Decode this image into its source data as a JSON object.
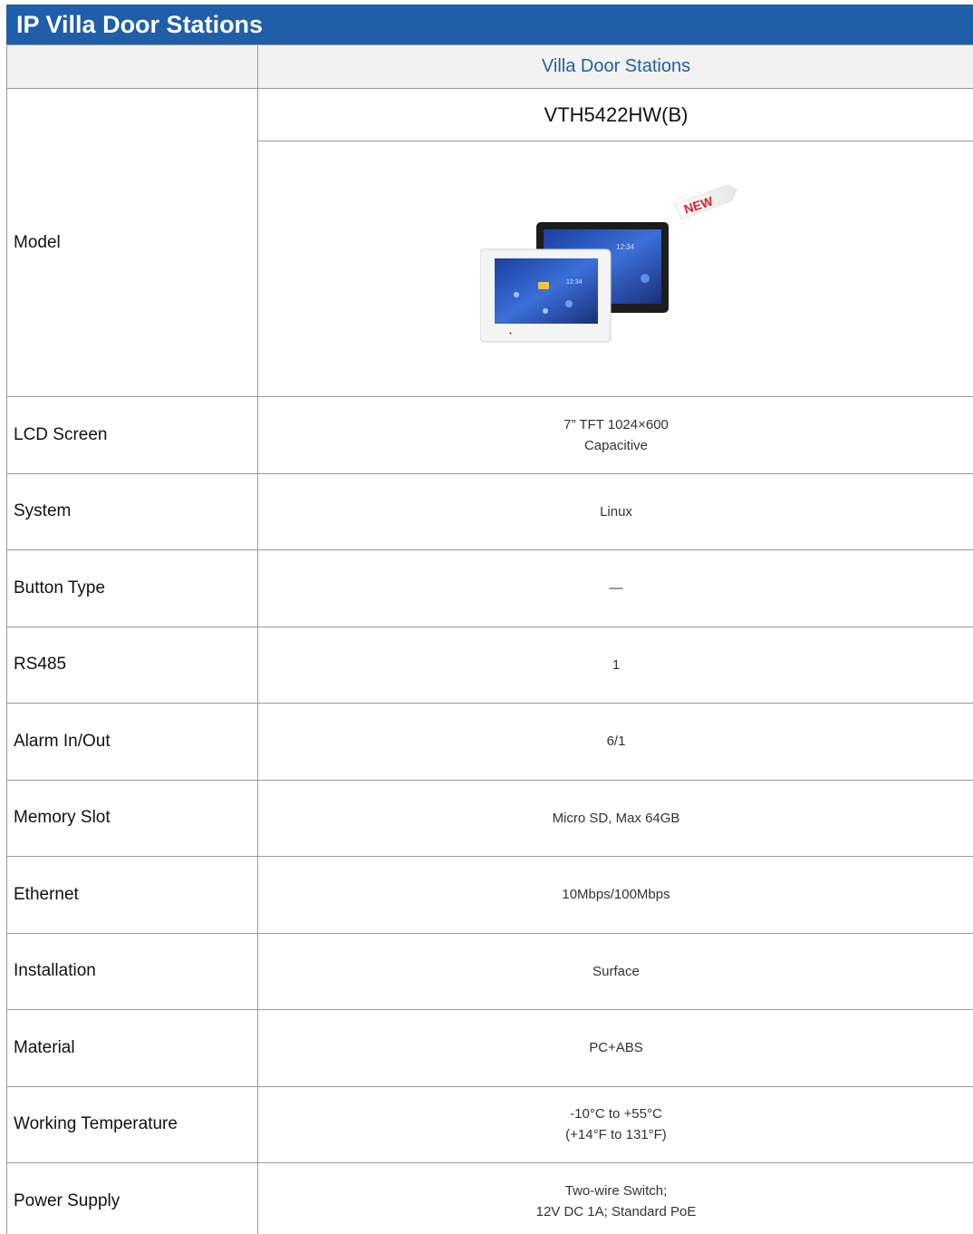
{
  "page": {
    "title": "IP Villa Door Stations",
    "series_header": "Villa Door Stations",
    "model_label": "Model",
    "model_name": "VTH5422HW(B)",
    "new_badge": "NEW",
    "screen_clock": "12:34"
  },
  "colors": {
    "brand_blue": "#1f5ea8",
    "header_gray": "#f2f2f2",
    "new_badge_red": "#d9232d"
  },
  "specs": [
    {
      "label": "LCD Screen",
      "value": [
        "7” TFT 1024×600",
        "Capacitive"
      ]
    },
    {
      "label": "System",
      "value": [
        "Linux"
      ]
    },
    {
      "label": "Button Type",
      "value": [
        "—"
      ]
    },
    {
      "label": "RS485",
      "value": [
        "1"
      ]
    },
    {
      "label": "Alarm In/Out",
      "value": [
        "6/1"
      ]
    },
    {
      "label": "Memory Slot",
      "value": [
        "Micro SD, Max 64GB"
      ]
    },
    {
      "label": "Ethernet",
      "value": [
        "10Mbps/100Mbps"
      ]
    },
    {
      "label": "Installation",
      "value": [
        "Surface"
      ]
    },
    {
      "label": "Material",
      "value": [
        "PC+ABS"
      ]
    },
    {
      "label": "Working Temperature",
      "value": [
        "-10°C to +55°C",
        "(+14°F to 131°F)"
      ]
    },
    {
      "label": "Power Supply",
      "value": [
        "Two-wire Switch;",
        "12V DC 1A; Standard PoE"
      ]
    }
  ]
}
